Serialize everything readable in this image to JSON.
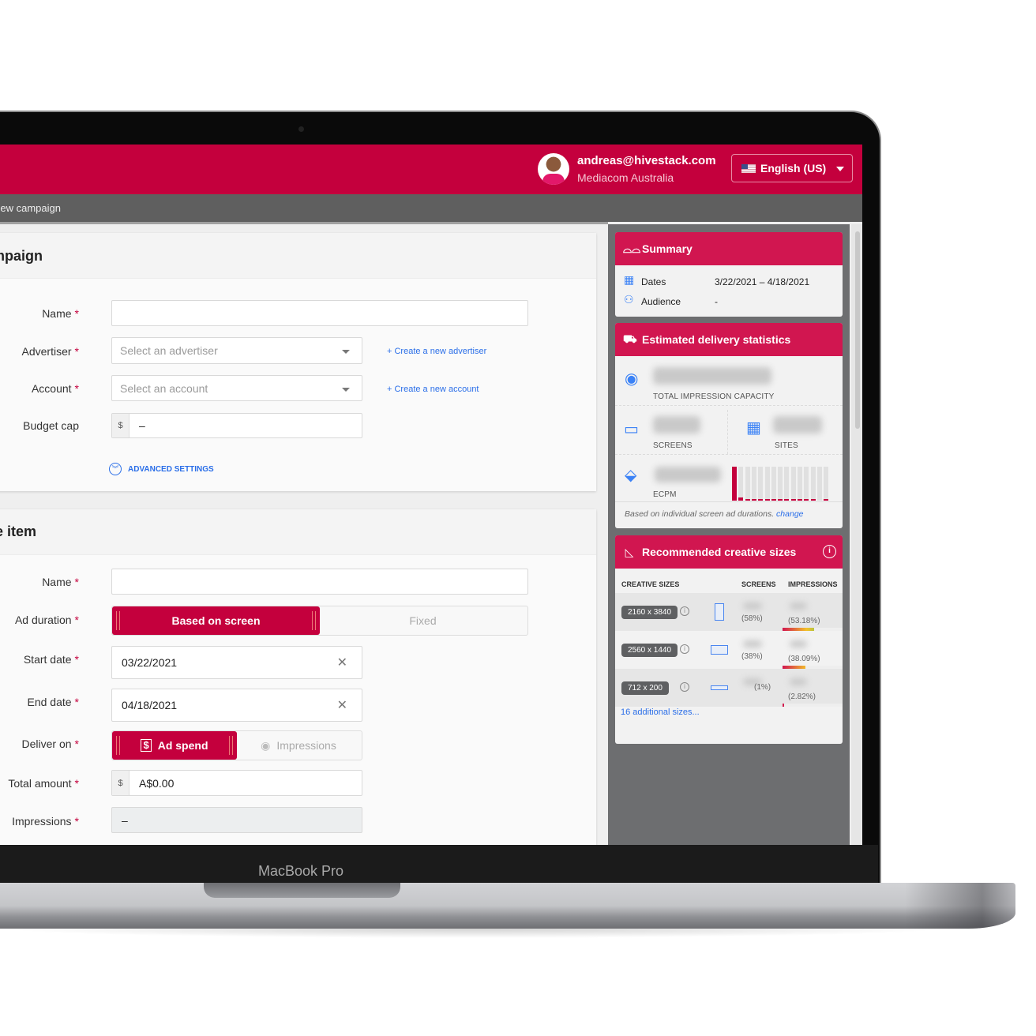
{
  "device": {
    "brand": "MacBook Pro"
  },
  "header": {
    "user_email": "andreas@hivestack.com",
    "organization": "Mediacom Australia",
    "language": "English (US)"
  },
  "breadcrumb": "New campaign",
  "campaign": {
    "title": "Campaign",
    "fields": {
      "name_label": "Name",
      "advertiser_label": "Advertiser",
      "advertiser_placeholder": "Select an advertiser",
      "create_advertiser": "+ Create a new advertiser",
      "account_label": "Account",
      "account_placeholder": "Select an account",
      "create_account": "+ Create a new account",
      "budget_label": "Budget cap",
      "budget_prefix": "$",
      "budget_value": "–"
    },
    "advanced_settings": "ADVANCED SETTINGS"
  },
  "line_item": {
    "title": "Line item",
    "name_label": "Name",
    "ad_duration_label": "Ad duration",
    "ad_duration_options": [
      "Based on screen",
      "Fixed"
    ],
    "ad_duration_selected": "Based on screen",
    "start_date_label": "Start date",
    "start_date": "03/22/2021",
    "end_date_label": "End date",
    "end_date": "04/18/2021",
    "deliver_on_label": "Deliver on",
    "deliver_on_options": [
      "Ad spend",
      "Impressions"
    ],
    "deliver_on_selected": "Ad spend",
    "total_amount_label": "Total amount",
    "total_prefix": "$",
    "total_amount": "A$0.00",
    "impressions_label": "Impressions",
    "impressions_value": "–",
    "required_marker": "*"
  },
  "summary": {
    "title": "Summary",
    "dates_label": "Dates",
    "dates_value": "3/22/2021 – 4/18/2021",
    "audience_label": "Audience",
    "audience_value": "-"
  },
  "delivery": {
    "title": "Estimated delivery statistics",
    "total_capacity_label": "TOTAL IMPRESSION CAPACITY",
    "screens_label": "SCREENS",
    "sites_label": "SITES",
    "ecpm_label": "ECPM",
    "footnote": "Based on individual screen ad durations.",
    "change_link": "change",
    "ecpm_histogram": [
      1,
      0.1,
      0.03,
      0.03,
      0.03,
      0.03,
      0.03,
      0.03,
      0.03,
      0.03,
      0.03,
      0.03,
      0.03,
      0,
      0.03
    ]
  },
  "creative": {
    "title": "Recommended creative sizes",
    "headers": [
      "CREATIVE SIZES",
      "SCREENS",
      "IMPRESSIONS"
    ],
    "rows": [
      {
        "size": "2160 x 3840",
        "screens_pct": "(58%)",
        "impressions_pct": "(53.18%)",
        "fill": 0.5318,
        "shape": "portrait"
      },
      {
        "size": "2560 x 1440",
        "screens_pct": "(38%)",
        "impressions_pct": "(38.09%)",
        "fill": 0.3809,
        "shape": "landscape"
      },
      {
        "size": "712 x 200",
        "screens_pct": "(1%)",
        "impressions_pct": "(2.82%)",
        "fill": 0.0282,
        "shape": "banner"
      }
    ],
    "more_link": "16 additional sizes..."
  },
  "colors": {
    "brand": "#c4003d",
    "accent_blue": "#2a6ee8",
    "sidebar": "#6d6e70"
  }
}
